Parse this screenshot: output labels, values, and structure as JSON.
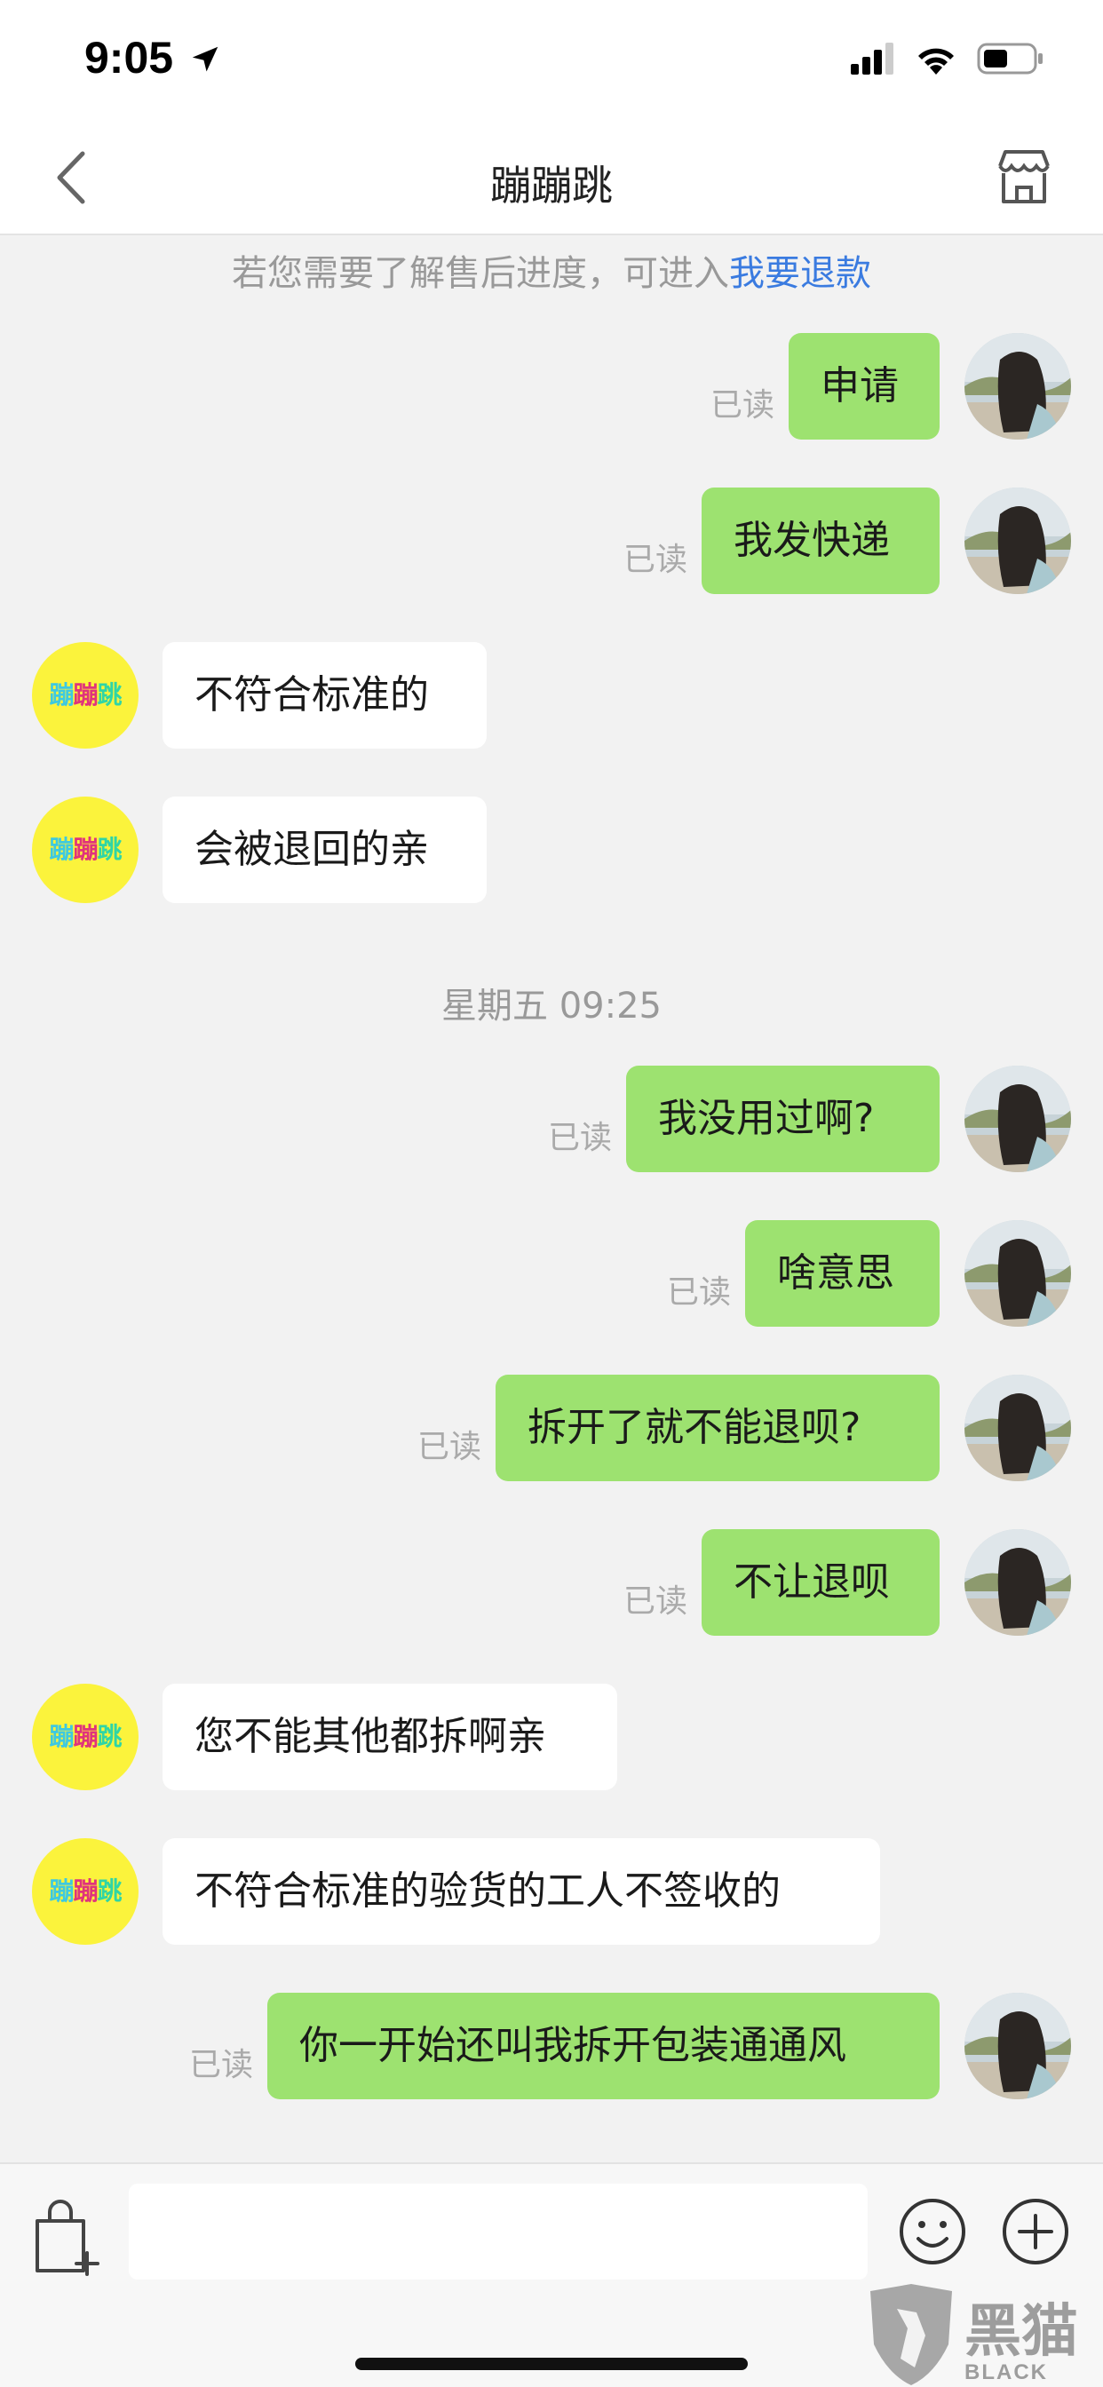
{
  "status_bar": {
    "time": "9:05"
  },
  "nav": {
    "title": "蹦蹦跳"
  },
  "tip": {
    "text": "若您需要了解售后进度，可进入",
    "link": "我要退款"
  },
  "time_separator": "星期五 09:25",
  "shop_avatar_text": [
    "蹦",
    "蹦",
    "跳"
  ],
  "read_label": "已读",
  "messages": [
    {
      "side": "me",
      "text": "申请"
    },
    {
      "side": "me",
      "text": "我发快递"
    },
    {
      "side": "them",
      "text": "不符合标准的"
    },
    {
      "side": "them",
      "text": "会被退回的亲"
    },
    {
      "side": "me",
      "text": "我没用过啊?"
    },
    {
      "side": "me",
      "text": "啥意思"
    },
    {
      "side": "me",
      "text": "拆开了就不能退呗?"
    },
    {
      "side": "me",
      "text": "不让退呗"
    },
    {
      "side": "them",
      "text": "您不能其他都拆啊亲"
    },
    {
      "side": "them",
      "text": "不符合标准的验货的工人不签收的"
    },
    {
      "side": "me",
      "text": "你一开始还叫我拆开包装通通风"
    }
  ],
  "input": {
    "value": "",
    "placeholder": ""
  },
  "watermark": {
    "cn": "黑猫",
    "en": "BLACK CAT"
  },
  "colors": {
    "my_bubble": "#9de270",
    "their_bubble": "#ffffff",
    "link": "#3a7be0",
    "shop_avatar_bg": "#fbf33c"
  }
}
